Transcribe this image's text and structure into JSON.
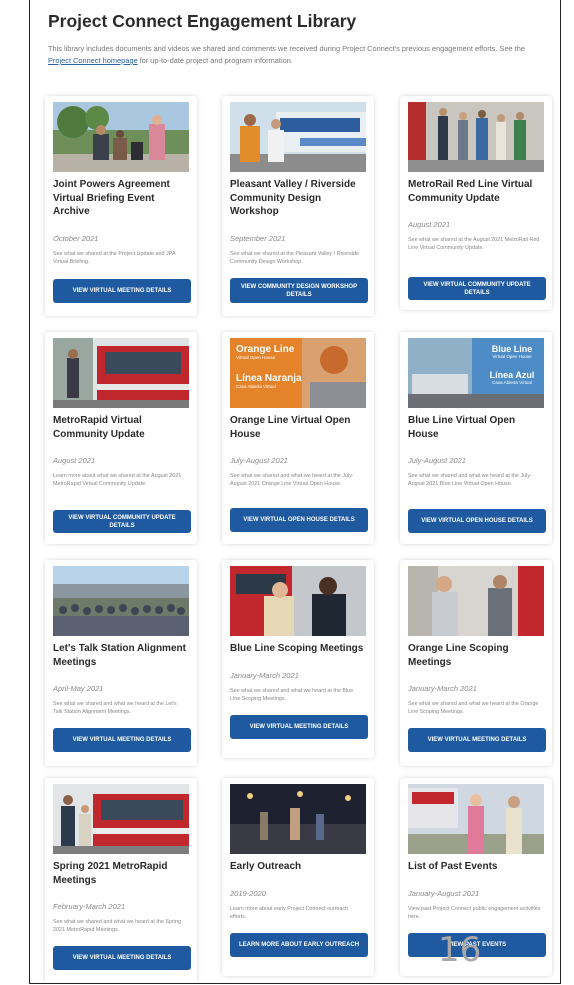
{
  "page": {
    "title": "Project Connect Engagement Library",
    "intro_before_link": "This library includes documents and videos we shared and comments we received during Project Connect's previous engagement efforts. See the ",
    "intro_link": "Project Connect homepage",
    "intro_after_link": " for up-to-date project and program information.",
    "page_number": "16"
  },
  "cards": [
    {
      "title": "Joint Powers Agreement Virtual Briefing Event Archive",
      "date": "October 2021",
      "description": "See what we shared at the Project Update and JPA Virtual Briefing.",
      "button": "VIEW VIRTUAL MEETING DETAILS",
      "image": "people-at-bus-stop-photo"
    },
    {
      "title": "Pleasant Valley / Riverside Community Design Workshop",
      "date": "September 2021",
      "description": "See what we shared at the Pleasant Valley / Riverside Community Design Workshop.",
      "button": "VIEW COMMUNITY DESIGN WORKSHOP DETAILS",
      "image": "people-near-bus-photo"
    },
    {
      "title": "MetroRail Red Line Virtual Community Update",
      "date": "August 2021",
      "description": "See what we shared at the August 2021 MetroRail Red Line Virtual Community Update.",
      "button": "VIEW VIRTUAL COMMUNITY UPDATE DETAILS",
      "image": "train-platform-photo"
    },
    {
      "title": "MetroRapid Virtual Community Update",
      "date": "August 2021",
      "description": "Learn more about what we shared at the August 2021 MetroRapid Virtual Community Update.",
      "button": "VIEW VIRTUAL COMMUNITY UPDATE DETAILS",
      "image": "metrorapid-bus-photo"
    },
    {
      "title": "Orange Line Virtual Open House",
      "date": "July-August 2021",
      "description": "See what we shared and what we heard at the July-August 2021 Orange Line Virtual Open House.",
      "button": "VIEW VIRTUAL OPEN HOUSE DETAILS",
      "image": "orange-line-banner",
      "banner_line1": "Orange Line",
      "banner_line1_sub": "Virtual Open House",
      "banner_line2": "Línea Naranja",
      "banner_line2_sub": "Casa Abierta Virtual"
    },
    {
      "title": "Blue Line Virtual Open House",
      "date": "July-August 2021",
      "description": "See what we shared and what we heard at the July-August 2021 Blue Line Virtual Open House.",
      "button": "VIEW VIRTUAL OPEN HOUSE DETAILS",
      "image": "blue-line-banner",
      "banner_line1": "Blue Line",
      "banner_line1_sub": "Virtual Open House",
      "banner_line2": "Línea Azul",
      "banner_line2_sub": "Casa Abierta Virtual"
    },
    {
      "title": "Let's Talk Station Alignment Meetings",
      "date": "April-May 2021",
      "description": "See what we shared and what we heard at the Let's Talk Station Alignment Meetings.",
      "button": "VIEW VIRTUAL MEETING DETAILS",
      "image": "crowd-at-station-photo"
    },
    {
      "title": "Blue Line Scoping Meetings",
      "date": "January-March 2021",
      "description": "See what we shared and what we heard at the Blue Line Scoping Meetings.",
      "button": "VIEW VIRTUAL MEETING DETAILS",
      "image": "two-men-talking-photo"
    },
    {
      "title": "Orange Line Scoping Meetings",
      "date": "January-March 2021",
      "description": "See what we shared and what we heard at the Orange Line Scoping Meetings.",
      "button": "VIEW VIRTUAL MEETING DETAILS",
      "image": "passengers-on-bus-photo"
    },
    {
      "title": "Spring 2021 MetroRapid Meetings",
      "date": "February-March 2021",
      "description": "See what we shared and what we heard at the Spring 2021 MetroRapid Meetings.",
      "button": "VIEW VIRTUAL MEETING DETAILS",
      "image": "metrorapid-bus-photo"
    },
    {
      "title": "Early Outreach",
      "date": "2019-2020",
      "description": "Learn more about early Project Connect outreach efforts.",
      "button": "LEARN MORE ABOUT EARLY OUTREACH",
      "image": "night-street-photo"
    },
    {
      "title": "List of Past Events",
      "date": "January-August 2021",
      "description": "View past Project Connect public engagement activities here.",
      "button": "VIEW PAST EVENTS",
      "image": "booth-with-people-photo"
    }
  ]
}
